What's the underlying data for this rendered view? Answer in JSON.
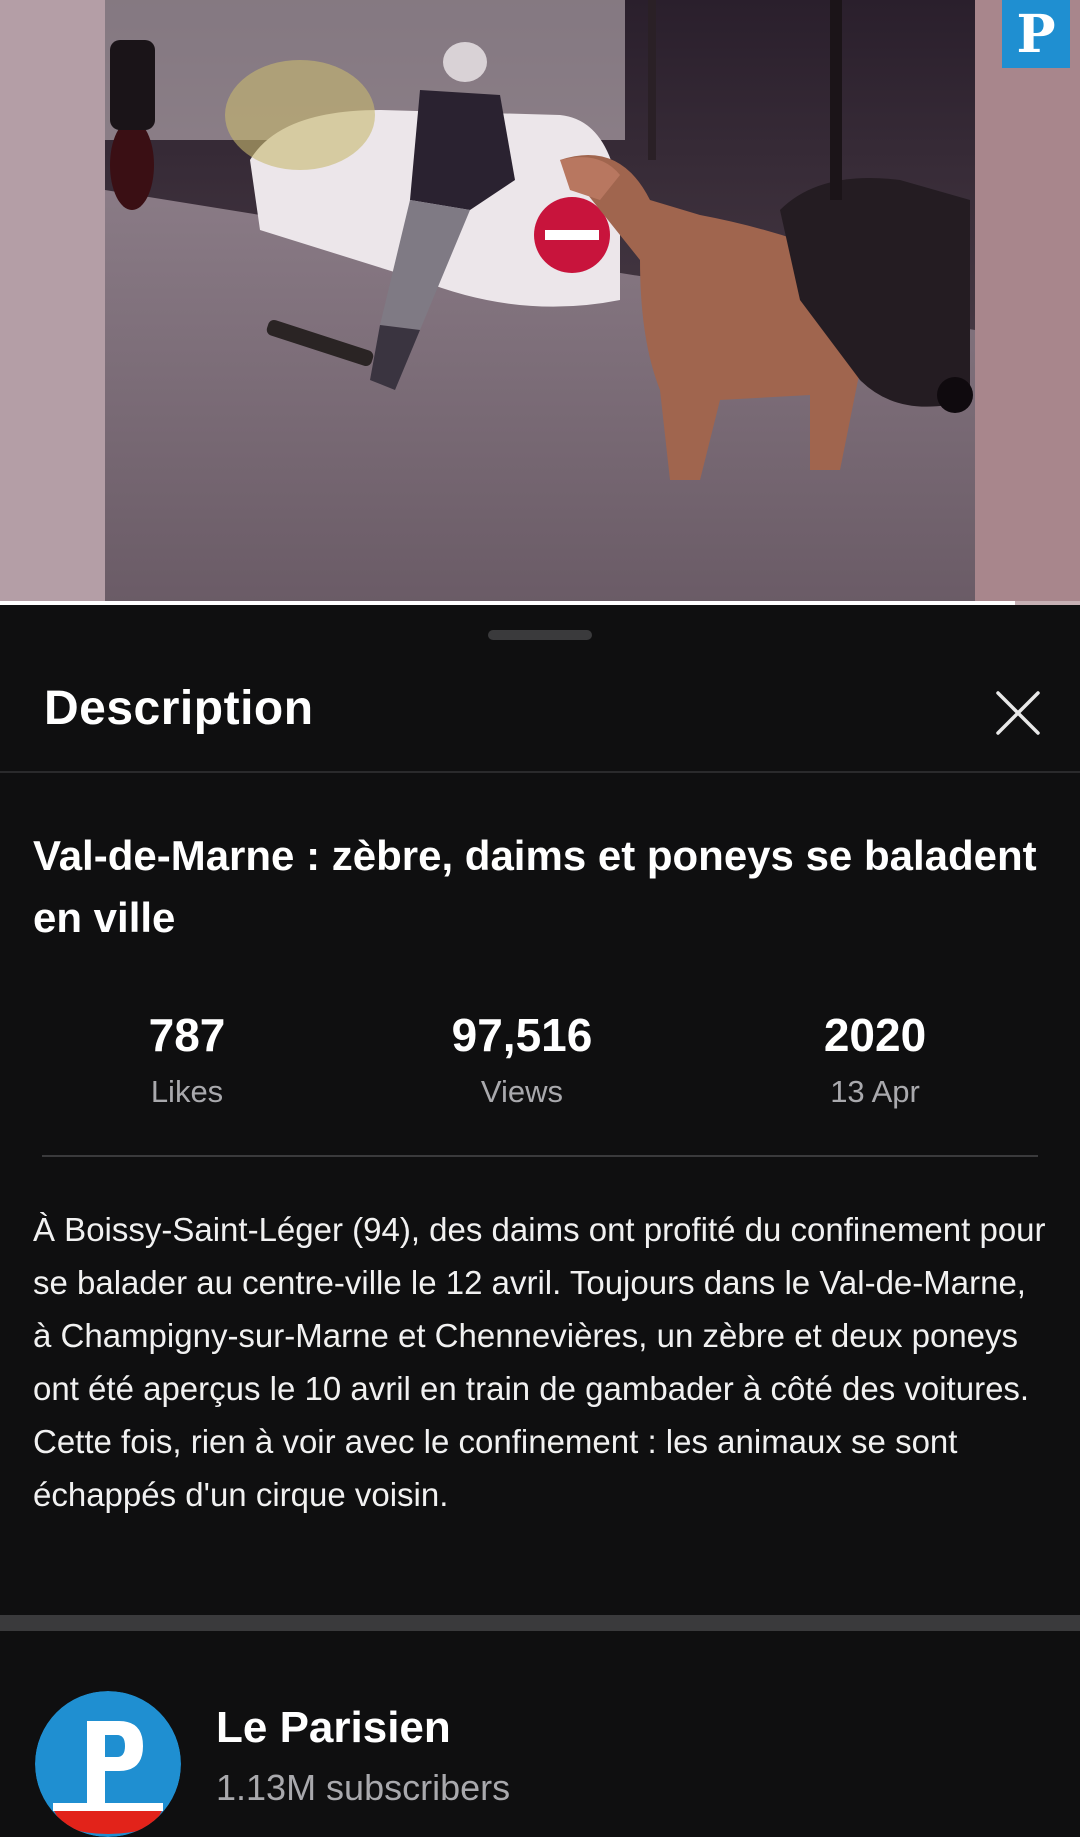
{
  "video": {
    "watermark_letter": "P",
    "progress_fraction": 0.94
  },
  "sheet": {
    "title": "Description",
    "close_icon": "close-icon"
  },
  "video_info": {
    "title": "Val-de-Marne : zèbre, daims et poneys se baladent en ville",
    "stats": {
      "likes_value": "787",
      "likes_label": "Likes",
      "views_value": "97,516",
      "views_label": "Views",
      "year_value": "2020",
      "date_label": "13 Apr"
    },
    "description": "À Boissy-Saint-Léger (94), des daims ont profité du confinement pour se balader au centre-ville le 12 avril. Toujours dans le Val-de-Marne, à Champigny-sur-Marne et Chennevières, un zèbre et deux poneys ont été aperçus le 10 avril en train de gambader à côté des voitures. Cette fois, rien à voir avec le confinement : les animaux se sont échappés d'un cirque voisin."
  },
  "channel": {
    "name": "Le Parisien",
    "subscribers": "1.13M subscribers",
    "avatar_letter": "P"
  },
  "colors": {
    "background": "#0f0f10",
    "brand_blue": "#1f8fd1",
    "brand_red": "#e2231a"
  }
}
